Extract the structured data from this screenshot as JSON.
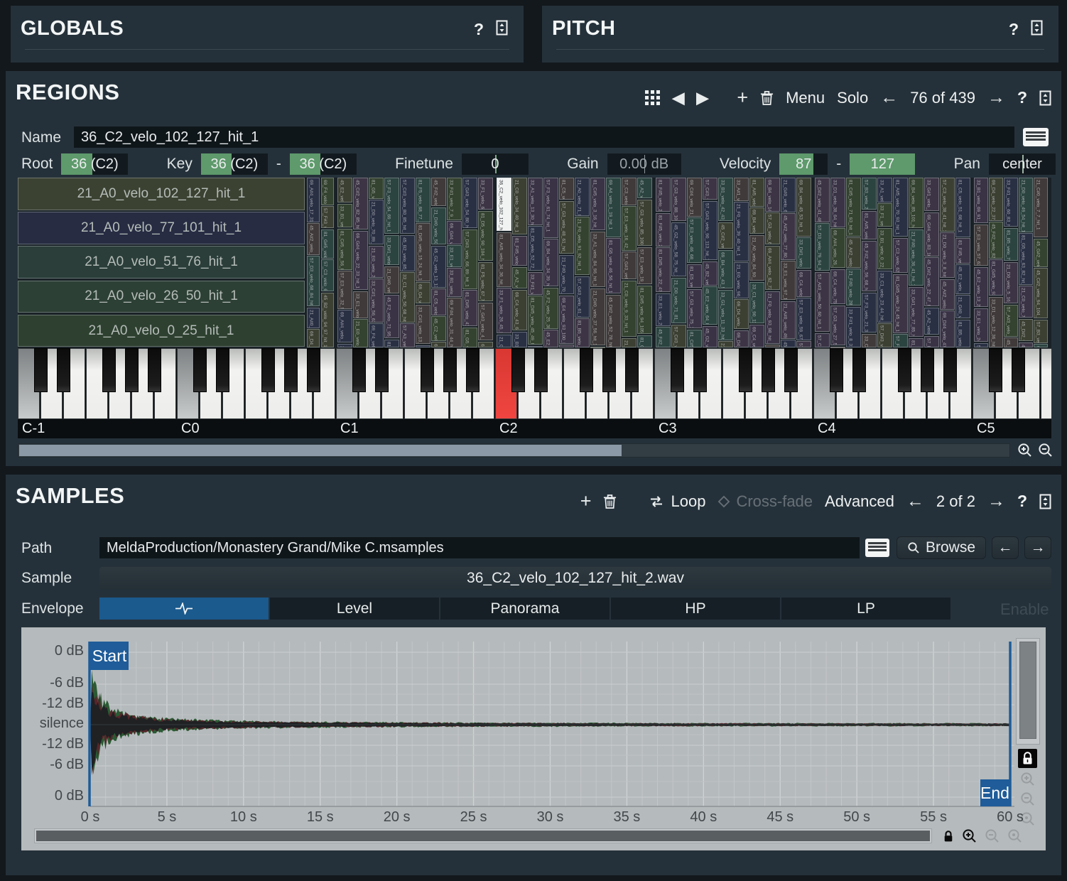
{
  "globals": {
    "title": "GLOBALS",
    "help": "?"
  },
  "pitch": {
    "title": "PITCH",
    "help": "?"
  },
  "regions": {
    "title": "REGIONS",
    "toolbar": {
      "menu": "Menu",
      "solo": "Solo",
      "counter": "76 of 439",
      "help": "?"
    },
    "name_label": "Name",
    "name_value": "36_C2_velo_102_127_hit_1",
    "params": {
      "root_label": "Root",
      "root_value": "36 (C2)",
      "key_label": "Key",
      "key_from": "36 (C2)",
      "key_sep": "-",
      "key_to": "36 (C2)",
      "finetune_label": "Finetune",
      "finetune_value": "0",
      "gain_label": "Gain",
      "gain_value": "0.00 dB",
      "velocity_label": "Velocity",
      "velocity_from": "87",
      "velocity_sep": "-",
      "velocity_to": "127",
      "pan_label": "Pan",
      "pan_value": "center"
    },
    "stacked_regions": [
      "21_A0_velo_102_127_hit_1",
      "21_A0_velo_77_101_hit_1",
      "21_A0_velo_51_76_hit_1",
      "21_A0_velo_26_50_hit_1",
      "21_A0_velo_0_25_hit_1"
    ],
    "stacked_region_colors": [
      "#3c4232",
      "#272c43",
      "#2b3e3a",
      "#2d4036",
      "#2e4130"
    ],
    "selected_region": "36_C2_velo_102_127_hit_1",
    "octave_labels": [
      "C-1",
      "C0",
      "C1",
      "C2",
      "C3",
      "C4",
      "C5"
    ],
    "mosaic_palette": [
      "#3c4033",
      "#3a3346",
      "#2c4440",
      "#2a3044",
      "#403a3a",
      "#344230",
      "#3d3545"
    ]
  },
  "samples": {
    "title": "SAMPLES",
    "toolbar": {
      "loop": "Loop",
      "crossfade": "Cross-fade",
      "advanced": "Advanced",
      "counter": "2 of 2",
      "help": "?"
    },
    "path_label": "Path",
    "path_value": "MeldaProduction/Monastery Grand/Mike C.msamples",
    "browse_label": "Browse",
    "sample_label": "Sample",
    "sample_value": "36_C2_velo_102_127_hit_2.wav",
    "envelope_label": "Envelope",
    "envelope_tabs": [
      "Level",
      "Panorama",
      "HP",
      "LP"
    ],
    "enable_label": "Enable",
    "waveform": {
      "db_labels": [
        "0 dB",
        "-6 dB",
        "-12 dB",
        "silence",
        "-12 dB",
        "-6 dB",
        "0 dB"
      ],
      "time_labels": [
        "0 s",
        "5 s",
        "10 s",
        "15 s",
        "20 s",
        "25 s",
        "30 s",
        "35 s",
        "40 s",
        "45 s",
        "50 s",
        "55 s",
        "60 s"
      ],
      "start_label": "Start",
      "end_label": "End"
    }
  },
  "colors": {
    "accent_blue": "#1f5c99",
    "accent_green": "#5e9a6b",
    "selected_key_red": "#ee3b35",
    "panel": "#25313a",
    "field": "#0f161a",
    "wave_bg": "#b5babc"
  }
}
